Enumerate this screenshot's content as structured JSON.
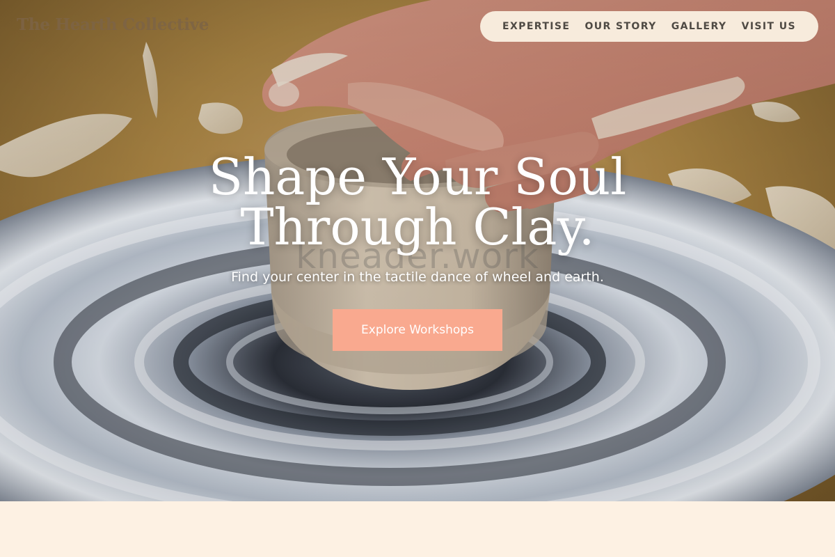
{
  "brand": {
    "name": "The Hearth Collective"
  },
  "nav": {
    "items": [
      {
        "label": "EXPERTISE"
      },
      {
        "label": "OUR STORY"
      },
      {
        "label": "GALLERY"
      },
      {
        "label": "VISIT US"
      }
    ]
  },
  "hero": {
    "headline_line1": "Shape Your Soul",
    "headline_line2": "Through Clay.",
    "watermark": "kneader.work",
    "subline": "Find your center in the tactile dance of wheel and earth.",
    "cta_label": "Explore Workshops",
    "image_subject": "hands shaping a clay bowl on a spinning pottery wheel"
  },
  "colors": {
    "page_background": "#fdf1e3",
    "nav_pill": "#f7ebdc",
    "cta_background": "#f9a98f",
    "nav_text": "#4f4a44",
    "brand_text": "#7d6446"
  }
}
